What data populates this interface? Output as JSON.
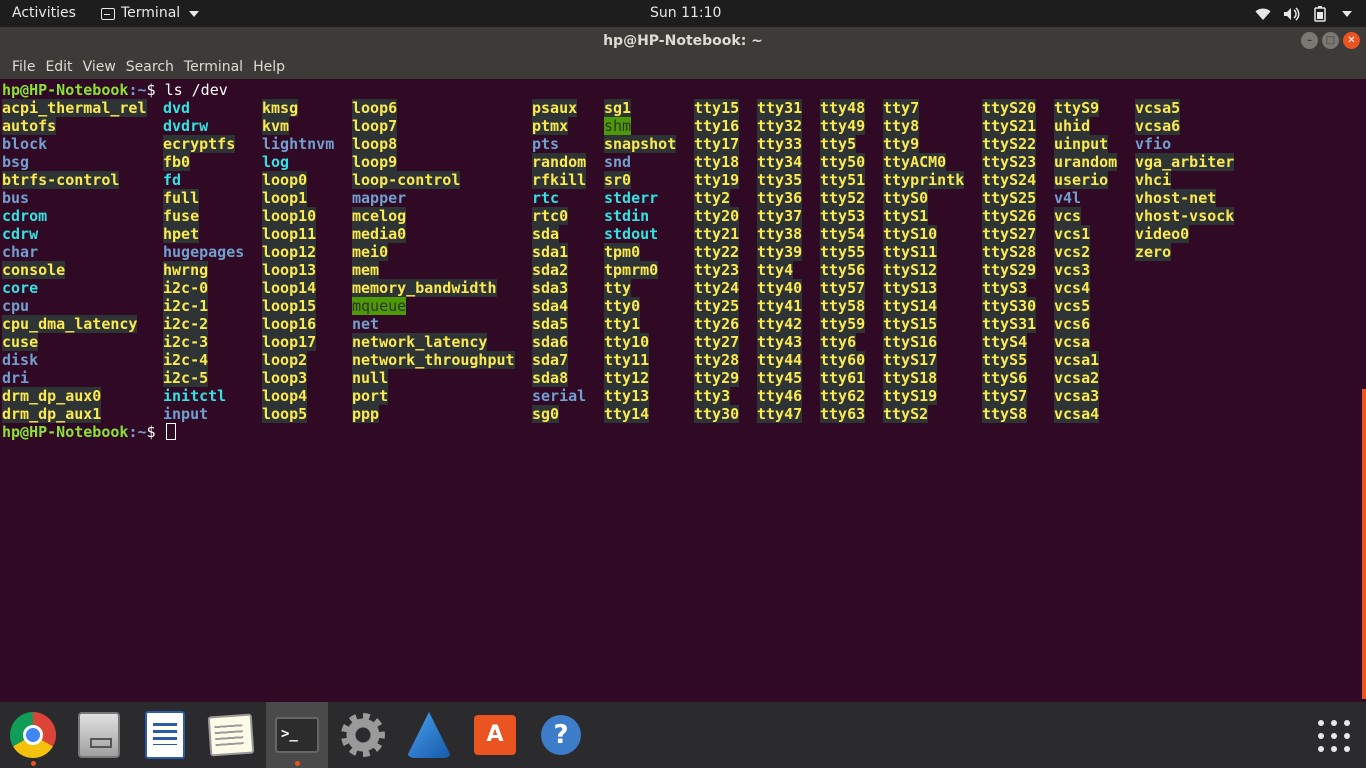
{
  "topbar": {
    "activities": "Activities",
    "app_menu": "Terminal",
    "clock": "Sun 11:10",
    "tray_icons": [
      "wifi-icon",
      "volume-icon",
      "battery-icon"
    ]
  },
  "window": {
    "title": "hp@HP-Notebook: ~",
    "controls": [
      "minimize",
      "maximize",
      "close"
    ]
  },
  "menubar": [
    "File",
    "Edit",
    "View",
    "Search",
    "Terminal",
    "Help"
  ],
  "terminal": {
    "prompt_user": "hp@HP-Notebook",
    "prompt_path": ":~",
    "prompt_symbol": "$ ",
    "command": "ls /dev",
    "colors": {
      "background": "#300a24",
      "device": "#fce94f",
      "directory": "#729fcf",
      "symlink": "#34e2e2",
      "sticky_bg": "#4e9a06"
    },
    "columns": [
      [
        [
          "acpi_thermal_rel",
          "dev"
        ],
        [
          "autofs",
          "dev"
        ],
        [
          "block",
          "dir"
        ],
        [
          "bsg",
          "dir"
        ],
        [
          "btrfs-control",
          "dev"
        ],
        [
          "bus",
          "dir"
        ],
        [
          "cdrom",
          "lnk"
        ],
        [
          "cdrw",
          "lnk"
        ],
        [
          "char",
          "dir"
        ],
        [
          "console",
          "dev"
        ],
        [
          "core",
          "lnk"
        ],
        [
          "cpu",
          "dir"
        ],
        [
          "cpu_dma_latency",
          "dev"
        ],
        [
          "cuse",
          "dev"
        ],
        [
          "disk",
          "dir"
        ],
        [
          "dri",
          "dir"
        ],
        [
          "drm_dp_aux0",
          "dev"
        ],
        [
          "drm_dp_aux1",
          "dev"
        ]
      ],
      [
        [
          "dvd",
          "lnk"
        ],
        [
          "dvdrw",
          "lnk"
        ],
        [
          "ecryptfs",
          "dev"
        ],
        [
          "fb0",
          "dev"
        ],
        [
          "fd",
          "lnk"
        ],
        [
          "full",
          "dev"
        ],
        [
          "fuse",
          "dev"
        ],
        [
          "hpet",
          "dev"
        ],
        [
          "hugepages",
          "dir"
        ],
        [
          "hwrng",
          "dev"
        ],
        [
          "i2c-0",
          "dev"
        ],
        [
          "i2c-1",
          "dev"
        ],
        [
          "i2c-2",
          "dev"
        ],
        [
          "i2c-3",
          "dev"
        ],
        [
          "i2c-4",
          "dev"
        ],
        [
          "i2c-5",
          "dev"
        ],
        [
          "initctl",
          "lnk"
        ],
        [
          "input",
          "dir"
        ]
      ],
      [
        [
          "kmsg",
          "dev"
        ],
        [
          "kvm",
          "dev"
        ],
        [
          "lightnvm",
          "dir"
        ],
        [
          "log",
          "lnk"
        ],
        [
          "loop0",
          "dev"
        ],
        [
          "loop1",
          "dev"
        ],
        [
          "loop10",
          "dev"
        ],
        [
          "loop11",
          "dev"
        ],
        [
          "loop12",
          "dev"
        ],
        [
          "loop13",
          "dev"
        ],
        [
          "loop14",
          "dev"
        ],
        [
          "loop15",
          "dev"
        ],
        [
          "loop16",
          "dev"
        ],
        [
          "loop17",
          "dev"
        ],
        [
          "loop2",
          "dev"
        ],
        [
          "loop3",
          "dev"
        ],
        [
          "loop4",
          "dev"
        ],
        [
          "loop5",
          "dev"
        ]
      ],
      [
        [
          "loop6",
          "dev"
        ],
        [
          "loop7",
          "dev"
        ],
        [
          "loop8",
          "dev"
        ],
        [
          "loop9",
          "dev"
        ],
        [
          "loop-control",
          "dev"
        ],
        [
          "mapper",
          "dir"
        ],
        [
          "mcelog",
          "dev"
        ],
        [
          "media0",
          "dev"
        ],
        [
          "mei0",
          "dev"
        ],
        [
          "mem",
          "dev"
        ],
        [
          "memory_bandwidth",
          "dev"
        ],
        [
          "mqueue",
          "sticky"
        ],
        [
          "net",
          "dir"
        ],
        [
          "network_latency",
          "dev"
        ],
        [
          "network_throughput",
          "dev"
        ],
        [
          "null",
          "dev"
        ],
        [
          "port",
          "dev"
        ],
        [
          "ppp",
          "dev"
        ]
      ],
      [
        [
          "psaux",
          "dev"
        ],
        [
          "ptmx",
          "dev"
        ],
        [
          "pts",
          "dir"
        ],
        [
          "random",
          "dev"
        ],
        [
          "rfkill",
          "dev"
        ],
        [
          "rtc",
          "lnk"
        ],
        [
          "rtc0",
          "dev"
        ],
        [
          "sda",
          "dev"
        ],
        [
          "sda1",
          "dev"
        ],
        [
          "sda2",
          "dev"
        ],
        [
          "sda3",
          "dev"
        ],
        [
          "sda4",
          "dev"
        ],
        [
          "sda5",
          "dev"
        ],
        [
          "sda6",
          "dev"
        ],
        [
          "sda7",
          "dev"
        ],
        [
          "sda8",
          "dev"
        ],
        [
          "serial",
          "dir"
        ],
        [
          "sg0",
          "dev"
        ]
      ],
      [
        [
          "sg1",
          "dev"
        ],
        [
          "shm",
          "sticky"
        ],
        [
          "snapshot",
          "dev"
        ],
        [
          "snd",
          "dir"
        ],
        [
          "sr0",
          "dev"
        ],
        [
          "stderr",
          "lnk"
        ],
        [
          "stdin",
          "lnk"
        ],
        [
          "stdout",
          "lnk"
        ],
        [
          "tpm0",
          "dev"
        ],
        [
          "tpmrm0",
          "dev"
        ],
        [
          "tty",
          "dev"
        ],
        [
          "tty0",
          "dev"
        ],
        [
          "tty1",
          "dev"
        ],
        [
          "tty10",
          "dev"
        ],
        [
          "tty11",
          "dev"
        ],
        [
          "tty12",
          "dev"
        ],
        [
          "tty13",
          "dev"
        ],
        [
          "tty14",
          "dev"
        ]
      ],
      [
        [
          "tty15",
          "dev"
        ],
        [
          "tty16",
          "dev"
        ],
        [
          "tty17",
          "dev"
        ],
        [
          "tty18",
          "dev"
        ],
        [
          "tty19",
          "dev"
        ],
        [
          "tty2",
          "dev"
        ],
        [
          "tty20",
          "dev"
        ],
        [
          "tty21",
          "dev"
        ],
        [
          "tty22",
          "dev"
        ],
        [
          "tty23",
          "dev"
        ],
        [
          "tty24",
          "dev"
        ],
        [
          "tty25",
          "dev"
        ],
        [
          "tty26",
          "dev"
        ],
        [
          "tty27",
          "dev"
        ],
        [
          "tty28",
          "dev"
        ],
        [
          "tty29",
          "dev"
        ],
        [
          "tty3",
          "dev"
        ],
        [
          "tty30",
          "dev"
        ]
      ],
      [
        [
          "tty31",
          "dev"
        ],
        [
          "tty32",
          "dev"
        ],
        [
          "tty33",
          "dev"
        ],
        [
          "tty34",
          "dev"
        ],
        [
          "tty35",
          "dev"
        ],
        [
          "tty36",
          "dev"
        ],
        [
          "tty37",
          "dev"
        ],
        [
          "tty38",
          "dev"
        ],
        [
          "tty39",
          "dev"
        ],
        [
          "tty4",
          "dev"
        ],
        [
          "tty40",
          "dev"
        ],
        [
          "tty41",
          "dev"
        ],
        [
          "tty42",
          "dev"
        ],
        [
          "tty43",
          "dev"
        ],
        [
          "tty44",
          "dev"
        ],
        [
          "tty45",
          "dev"
        ],
        [
          "tty46",
          "dev"
        ],
        [
          "tty47",
          "dev"
        ]
      ],
      [
        [
          "tty48",
          "dev"
        ],
        [
          "tty49",
          "dev"
        ],
        [
          "tty5",
          "dev"
        ],
        [
          "tty50",
          "dev"
        ],
        [
          "tty51",
          "dev"
        ],
        [
          "tty52",
          "dev"
        ],
        [
          "tty53",
          "dev"
        ],
        [
          "tty54",
          "dev"
        ],
        [
          "tty55",
          "dev"
        ],
        [
          "tty56",
          "dev"
        ],
        [
          "tty57",
          "dev"
        ],
        [
          "tty58",
          "dev"
        ],
        [
          "tty59",
          "dev"
        ],
        [
          "tty6",
          "dev"
        ],
        [
          "tty60",
          "dev"
        ],
        [
          "tty61",
          "dev"
        ],
        [
          "tty62",
          "dev"
        ],
        [
          "tty63",
          "dev"
        ]
      ],
      [
        [
          "tty7",
          "dev"
        ],
        [
          "tty8",
          "dev"
        ],
        [
          "tty9",
          "dev"
        ],
        [
          "ttyACM0",
          "dev"
        ],
        [
          "ttyprintk",
          "dev"
        ],
        [
          "ttyS0",
          "dev"
        ],
        [
          "ttyS1",
          "dev"
        ],
        [
          "ttyS10",
          "dev"
        ],
        [
          "ttyS11",
          "dev"
        ],
        [
          "ttyS12",
          "dev"
        ],
        [
          "ttyS13",
          "dev"
        ],
        [
          "ttyS14",
          "dev"
        ],
        [
          "ttyS15",
          "dev"
        ],
        [
          "ttyS16",
          "dev"
        ],
        [
          "ttyS17",
          "dev"
        ],
        [
          "ttyS18",
          "dev"
        ],
        [
          "ttyS19",
          "dev"
        ],
        [
          "ttyS2",
          "dev"
        ]
      ],
      [
        [
          "ttyS20",
          "dev"
        ],
        [
          "ttyS21",
          "dev"
        ],
        [
          "ttyS22",
          "dev"
        ],
        [
          "ttyS23",
          "dev"
        ],
        [
          "ttyS24",
          "dev"
        ],
        [
          "ttyS25",
          "dev"
        ],
        [
          "ttyS26",
          "dev"
        ],
        [
          "ttyS27",
          "dev"
        ],
        [
          "ttyS28",
          "dev"
        ],
        [
          "ttyS29",
          "dev"
        ],
        [
          "ttyS3",
          "dev"
        ],
        [
          "ttyS30",
          "dev"
        ],
        [
          "ttyS31",
          "dev"
        ],
        [
          "ttyS4",
          "dev"
        ],
        [
          "ttyS5",
          "dev"
        ],
        [
          "ttyS6",
          "dev"
        ],
        [
          "ttyS7",
          "dev"
        ],
        [
          "ttyS8",
          "dev"
        ]
      ],
      [
        [
          "ttyS9",
          "dev"
        ],
        [
          "uhid",
          "dev"
        ],
        [
          "uinput",
          "dev"
        ],
        [
          "urandom",
          "dev"
        ],
        [
          "userio",
          "dev"
        ],
        [
          "v4l",
          "dir"
        ],
        [
          "vcs",
          "dev"
        ],
        [
          "vcs1",
          "dev"
        ],
        [
          "vcs2",
          "dev"
        ],
        [
          "vcs3",
          "dev"
        ],
        [
          "vcs4",
          "dev"
        ],
        [
          "vcs5",
          "dev"
        ],
        [
          "vcs6",
          "dev"
        ],
        [
          "vcsa",
          "dev"
        ],
        [
          "vcsa1",
          "dev"
        ],
        [
          "vcsa2",
          "dev"
        ],
        [
          "vcsa3",
          "dev"
        ],
        [
          "vcsa4",
          "dev"
        ]
      ],
      [
        [
          "vcsa5",
          "dev"
        ],
        [
          "vcsa6",
          "dev"
        ],
        [
          "vfio",
          "dir"
        ],
        [
          "vga_arbiter",
          "dev"
        ],
        [
          "vhci",
          "dev"
        ],
        [
          "vhost-net",
          "dev"
        ],
        [
          "vhost-vsock",
          "dev"
        ],
        [
          "video0",
          "dev"
        ],
        [
          "zero",
          "dev"
        ]
      ]
    ]
  },
  "dock": {
    "apps": [
      {
        "name": "chrome",
        "icon": "chrome-icon",
        "running": true
      },
      {
        "name": "files",
        "icon": "files-icon",
        "running": false
      },
      {
        "name": "writer",
        "icon": "writer-icon",
        "running": false
      },
      {
        "name": "text-editor",
        "icon": "text-editor-icon",
        "running": false
      },
      {
        "name": "terminal",
        "icon": "terminal-icon",
        "running": true
      },
      {
        "name": "settings",
        "icon": "settings-icon",
        "running": false
      },
      {
        "name": "wireshark",
        "icon": "wireshark-icon",
        "running": false
      },
      {
        "name": "software",
        "icon": "software-icon",
        "running": false
      },
      {
        "name": "help",
        "icon": "help-icon",
        "running": false
      }
    ],
    "show_apps_icon": "grid-icon"
  }
}
